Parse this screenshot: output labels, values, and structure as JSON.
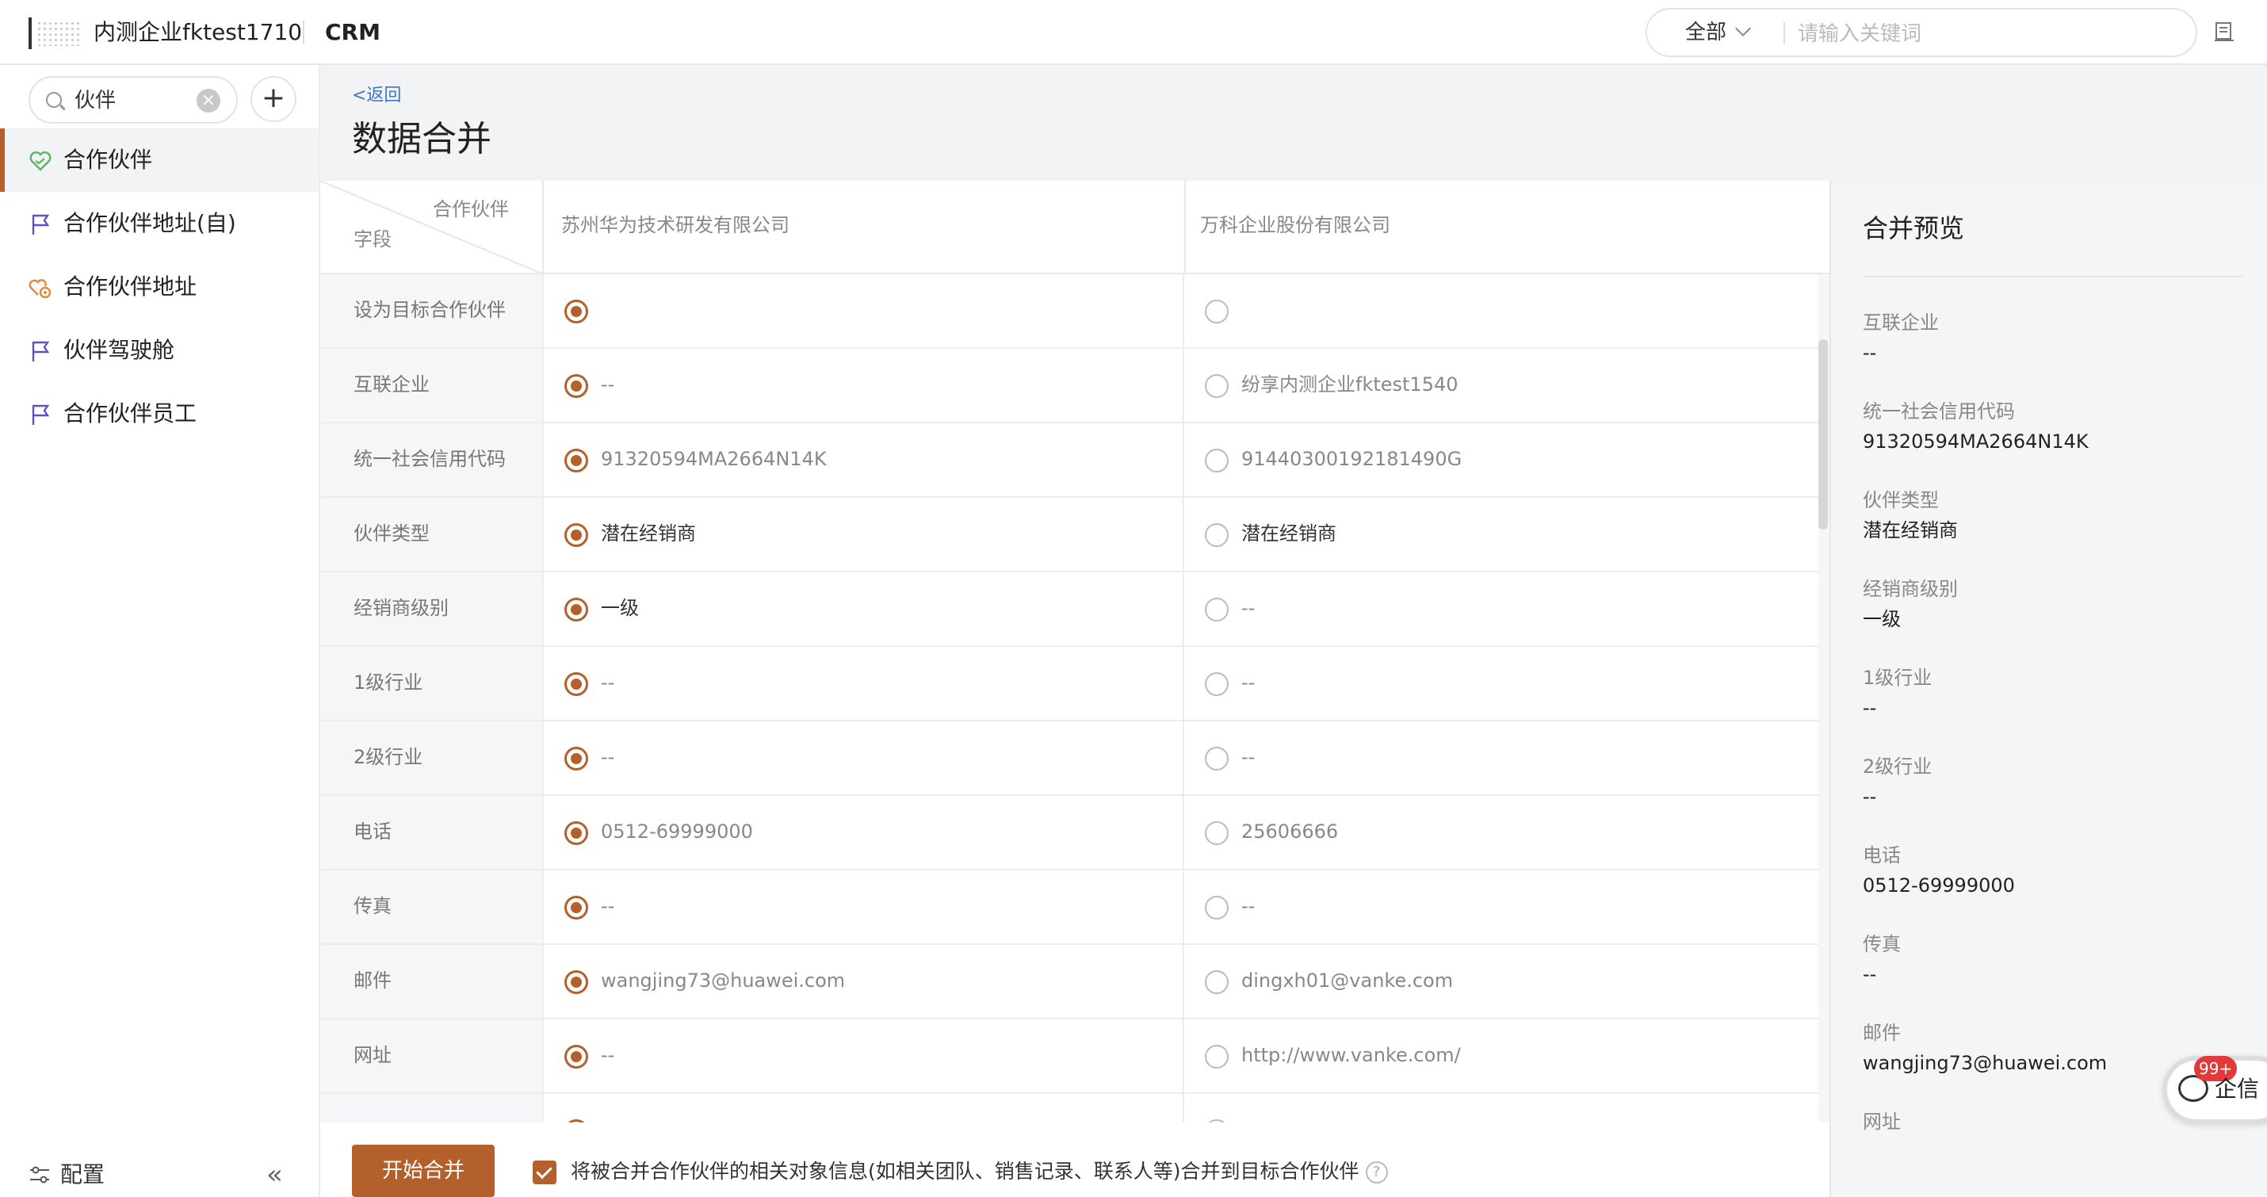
{
  "header": {
    "tenant": "内测企业fktest1710",
    "app": "CRM",
    "scope": "全部",
    "search_placeholder": "请输入关键词"
  },
  "sidebar": {
    "search_value": "伙伴",
    "items": [
      {
        "label": "合作伙伴",
        "icon": "heart-handshake-icon",
        "active": true
      },
      {
        "label": "合作伙伴地址(自)",
        "icon": "flag-icon"
      },
      {
        "label": "合作伙伴地址",
        "icon": "location-handshake-icon"
      },
      {
        "label": "伙伴驾驶舱",
        "icon": "flag-icon"
      },
      {
        "label": "合作伙伴员工",
        "icon": "flag-icon"
      }
    ],
    "config_label": "配置",
    "collapse_label": "«"
  },
  "page": {
    "back_label": "<返回",
    "title": "数据合并"
  },
  "merge_table": {
    "corner_top": "合作伙伴",
    "corner_bottom": "字段",
    "columns": [
      "苏州华为技术研发有限公司",
      "万科企业股份有限公司"
    ],
    "rows": [
      {
        "field": "设为目标合作伙伴",
        "a": "",
        "b": "",
        "selected": "a"
      },
      {
        "field": "互联企业",
        "a": "--",
        "b": "纷享内测企业fktest1540",
        "selected": "a"
      },
      {
        "field": "统一社会信用代码",
        "a": "91320594MA2664N14K",
        "b": "91440300192181490G",
        "selected": "a"
      },
      {
        "field": "伙伴类型",
        "a": "潜在经销商",
        "b": "潜在经销商",
        "selected": "a"
      },
      {
        "field": "经销商级别",
        "a": "一级",
        "b": "--",
        "selected": "a"
      },
      {
        "field": "1级行业",
        "a": "--",
        "b": "--",
        "selected": "a"
      },
      {
        "field": "2级行业",
        "a": "--",
        "b": "--",
        "selected": "a"
      },
      {
        "field": "电话",
        "a": "0512-69999000",
        "b": "25606666",
        "selected": "a"
      },
      {
        "field": "传真",
        "a": "--",
        "b": "--",
        "selected": "a"
      },
      {
        "field": "邮件",
        "a": "wangjing73@huawei.com",
        "b": "dingxh01@vanke.com",
        "selected": "a"
      },
      {
        "field": "网址",
        "a": "--",
        "b": "http://www.vanke.com/",
        "selected": "a"
      }
    ]
  },
  "preview": {
    "title": "合并预览",
    "items": [
      {
        "key": "互联企业",
        "value": "--"
      },
      {
        "key": "统一社会信用代码",
        "value": "91320594MA2664N14K"
      },
      {
        "key": "伙伴类型",
        "value": "潜在经销商"
      },
      {
        "key": "经销商级别",
        "value": "一级"
      },
      {
        "key": "1级行业",
        "value": "--"
      },
      {
        "key": "2级行业",
        "value": "--"
      },
      {
        "key": "电话",
        "value": "0512-69999000"
      },
      {
        "key": "传真",
        "value": "--"
      },
      {
        "key": "邮件",
        "value": "wangjing73@huawei.com"
      },
      {
        "key": "网址",
        "value": ""
      }
    ]
  },
  "footer": {
    "start_label": "开始合并",
    "checkbox_checked": true,
    "checkbox_label": "将被合并合作伙伴的相关对象信息(如相关团队、销售记录、联系人等)合并到目标合作伙伴",
    "help_glyph": "?"
  },
  "chat": {
    "badge": "99+",
    "label": "企信"
  },
  "colors": {
    "accent": "#b4602c",
    "link": "#3a78c8",
    "badge": "#e23a3a"
  }
}
